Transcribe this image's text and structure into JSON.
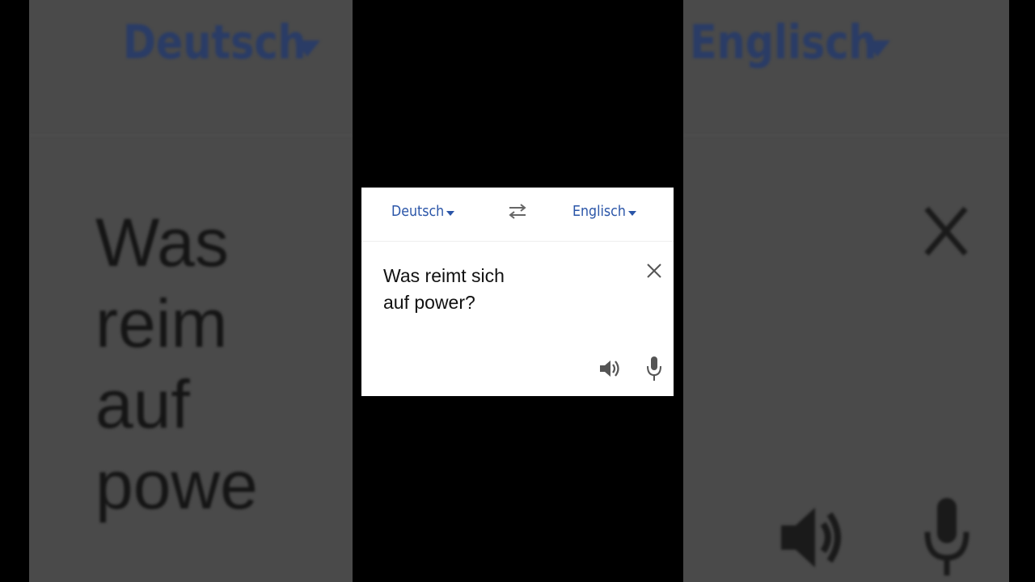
{
  "background": {
    "source_language": "Deutsch",
    "target_language": "Englisch",
    "input_text_fragment": "Was reim\nauf powe"
  },
  "card": {
    "source_language": "Deutsch",
    "target_language": "Englisch",
    "input_text": "Was reimt sich\nauf power?",
    "icons": {
      "swap": "swap-languages-icon",
      "clear": "close-icon",
      "speaker": "speaker-icon",
      "mic": "microphone-icon"
    }
  },
  "colors": {
    "accent": "#2a55a8",
    "background": "#000000",
    "card": "#ffffff"
  }
}
